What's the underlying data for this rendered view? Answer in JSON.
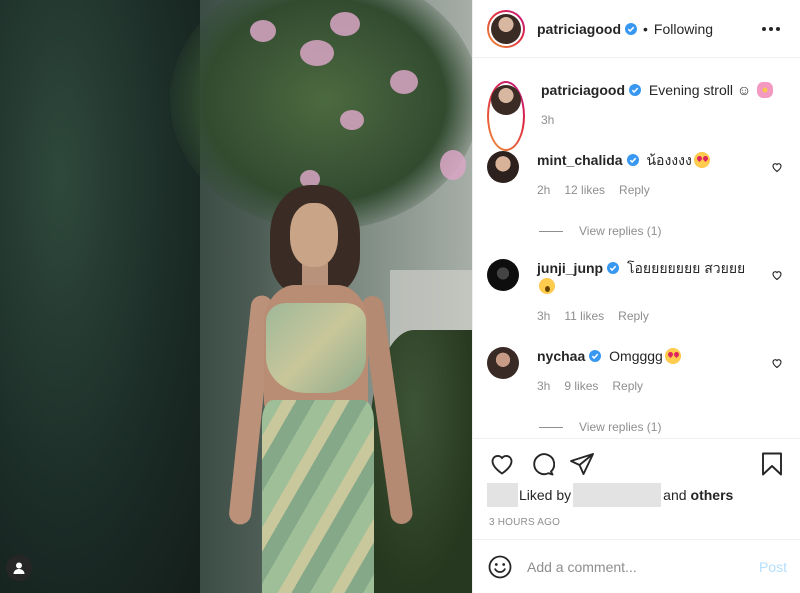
{
  "post": {
    "author": "patriciagood",
    "follow_separator": "•",
    "follow_state": "Following",
    "caption_text": "Evening stroll ☺",
    "caption_emoji": "blossom",
    "caption_time": "3h"
  },
  "comments": [
    {
      "username": "mint_chalida",
      "verified": true,
      "text": "น้องงงง",
      "emoji": "heart-eyes",
      "time": "2h",
      "likes": "12 likes",
      "reply": "Reply",
      "view_replies": "View replies (1)"
    },
    {
      "username": "junji_junp",
      "verified": true,
      "text": "โอยยยยยยย สวยยย",
      "emoji": "astonished",
      "time": "3h",
      "likes": "11 likes",
      "reply": "Reply",
      "view_replies": ""
    },
    {
      "username": "nychaa",
      "verified": true,
      "text": "Omgggg",
      "emoji": "heart-eyes",
      "time": "3h",
      "likes": "9 likes",
      "reply": "Reply",
      "view_replies": "View replies (1)"
    }
  ],
  "actions": {
    "liked_by_label": "Liked by",
    "and_label": "and",
    "others_label": "others",
    "time_ago": "3 HOURS AGO",
    "comment_placeholder": "Add a comment...",
    "post_label": "Post"
  },
  "icons": {
    "like": "heart-icon",
    "comment": "comment-icon",
    "share": "paper-plane-icon",
    "save": "bookmark-icon",
    "emoji": "smiley-icon",
    "tags": "user-tag-icon",
    "more": "more-options-icon"
  },
  "colors": {
    "verified": "#3897f0",
    "text": "#262626",
    "muted": "#8e8e8e",
    "post_disabled": "#b2dffc"
  }
}
